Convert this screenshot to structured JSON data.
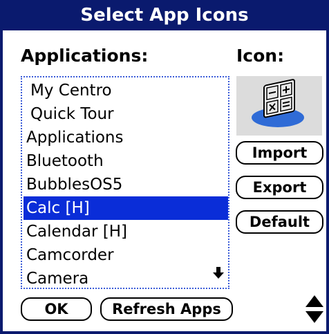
{
  "window": {
    "title": "Select App Icons"
  },
  "applications": {
    "heading": "Applications:",
    "items": [
      "My Centro",
      "Quick Tour",
      "Applications",
      "Bluetooth",
      "BubblesOS5",
      "Calc [H]",
      "Calendar [H]",
      "Camcorder",
      "Camera"
    ],
    "selected": "Calc [H]"
  },
  "icon_panel": {
    "heading": "Icon:",
    "preview_icon": "calculator-icon"
  },
  "buttons": {
    "import": "Import",
    "export": "Export",
    "default": "Default",
    "ok": "OK",
    "refresh": "Refresh Apps"
  },
  "colors": {
    "titlebar": "#0a1a6e",
    "selection": "#0a2dd8",
    "list_border": "#3a5bd8",
    "icon_bg": "#dcdcdc"
  }
}
